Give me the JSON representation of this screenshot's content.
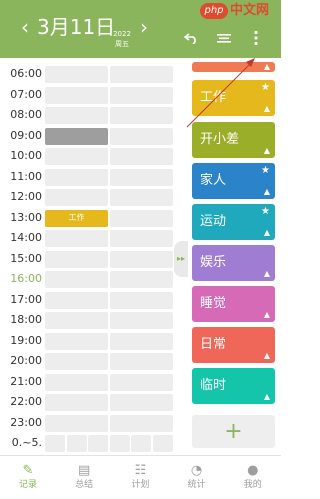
{
  "header": {
    "date": "3月11日",
    "year": "2022",
    "weekday": "周五",
    "prev_icon": "chevron-left-icon",
    "next_icon": "chevron-right-icon",
    "undo_icon": "undo-icon",
    "list_icon": "list-icon",
    "more_icon": "more-vert-icon"
  },
  "timeline": {
    "hours": [
      "06:00",
      "07:00",
      "08:00",
      "09:00",
      "10:00",
      "11:00",
      "12:00",
      "13:00",
      "14:00",
      "15:00",
      "16:00",
      "17:00",
      "18:00",
      "19:00",
      "20:00",
      "21:00",
      "22:00",
      "23:00",
      "0.~5."
    ],
    "current_hour": "16:00",
    "events": [
      {
        "hour": "09:00",
        "label": ""
      },
      {
        "hour": "13:00",
        "label": "工作"
      }
    ]
  },
  "categories": [
    {
      "label": "",
      "color": "#f07a52",
      "starred": false
    },
    {
      "label": "工作",
      "color": "#e5b81d",
      "starred": true
    },
    {
      "label": "开小差",
      "color": "#9aae2a",
      "starred": false
    },
    {
      "label": "家人",
      "color": "#2b83c9",
      "starred": true
    },
    {
      "label": "运动",
      "color": "#20a9bd",
      "starred": true
    },
    {
      "label": "娱乐",
      "color": "#9f7dd3",
      "starred": false
    },
    {
      "label": "睡觉",
      "color": "#d66ab7",
      "starred": false
    },
    {
      "label": "日常",
      "color": "#ee6759",
      "starred": false
    },
    {
      "label": "临时",
      "color": "#14c5a9",
      "starred": false
    }
  ],
  "add_label": "+",
  "bottom_nav": [
    {
      "label": "记录",
      "icon": "pencil-icon",
      "active": true
    },
    {
      "label": "总结",
      "icon": "summary-icon",
      "active": false
    },
    {
      "label": "计划",
      "icon": "plan-list-icon",
      "active": false
    },
    {
      "label": "统计",
      "icon": "pie-chart-icon",
      "active": false
    },
    {
      "label": "我的",
      "icon": "person-icon",
      "active": false
    }
  ],
  "watermark": {
    "badge": "php",
    "text": "中文网"
  },
  "colors": {
    "header": "#8ab55c",
    "accent": "#8ab55c",
    "cell": "#ededed"
  }
}
